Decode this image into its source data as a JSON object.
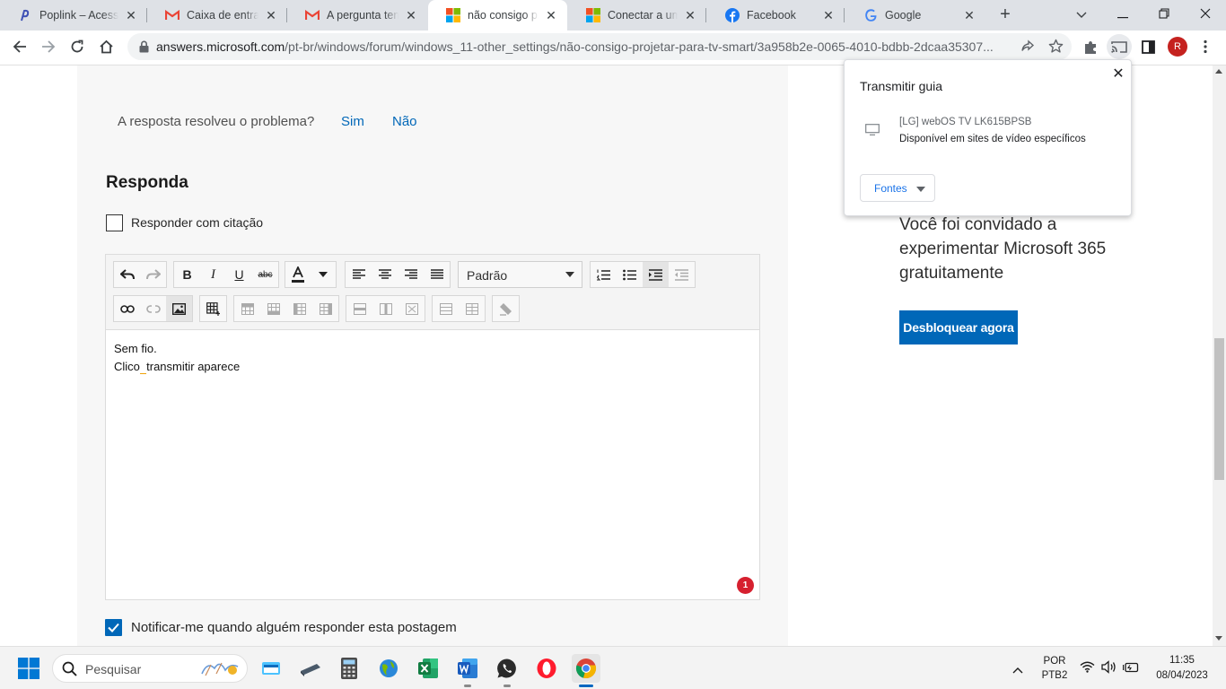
{
  "browser": {
    "tabs": [
      {
        "title": "Poplink – Acesse",
        "icon": "poplink-icon"
      },
      {
        "title": "Caixa de entrada",
        "icon": "gmail-icon"
      },
      {
        "title": "A pergunta tem u",
        "icon": "gmail-icon"
      },
      {
        "title": "não consigo proj",
        "icon": "microsoft-icon",
        "active": true
      },
      {
        "title": "Conectar a um p",
        "icon": "microsoft-icon"
      },
      {
        "title": "Facebook",
        "icon": "facebook-icon"
      },
      {
        "title": "Google",
        "icon": "google-icon"
      }
    ],
    "url_host": "answers.microsoft.com",
    "url_path": "/pt-br/windows/forum/windows_11-other_settings/não-consigo-projetar-para-tv-smart/3a958b2e-0065-4010-bdbb-2dcaa35307...",
    "profile_initial": "R"
  },
  "page": {
    "question": "A resposta resolveu o problema?",
    "yes": "Sim",
    "no": "Não",
    "reply_heading": "Responda",
    "quote_label": "Responder com citação",
    "editor": {
      "style_select": "Padrão",
      "lines": [
        "Sem fio.",
        "Clico",
        "transmitir aparece"
      ],
      "badge": "1"
    },
    "notify_label": "Notificar-me quando alguém responder esta postagem",
    "notify_checked": true,
    "promo_text": "Você foi convidado a experimentar Microsoft 365 gratuitamente",
    "promo_button": "Desbloquear agora"
  },
  "cast": {
    "title": "Transmitir guia",
    "device_name": "[LG] webOS TV LK615BPSB",
    "device_status": "Disponível em sites de vídeo específicos",
    "sources": "Fontes"
  },
  "taskbar": {
    "search_placeholder": "Pesquisar",
    "lang_top": "POR",
    "lang_bottom": "PTB2",
    "time": "11:35",
    "date": "08/04/2023"
  },
  "colors": {
    "accent": "#0067b8",
    "tabstrip": "#dee1e6",
    "badge": "#d6202f",
    "avatar": "#c5221f"
  }
}
